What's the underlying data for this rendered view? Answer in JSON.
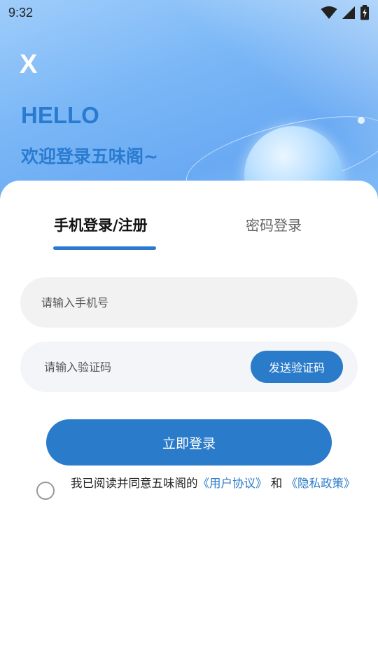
{
  "status_bar": {
    "time": "9:32",
    "icons": [
      "wifi-icon",
      "cell-signal-icon",
      "battery-charging-icon"
    ]
  },
  "header": {
    "close_label": "X",
    "hello": "HELLO",
    "welcome": "欢迎登录五味阁~"
  },
  "tabs": [
    {
      "label": "手机登录/注册",
      "active": true
    },
    {
      "label": "密码登录",
      "active": false
    }
  ],
  "form": {
    "phone_placeholder": "请输入手机号",
    "code_placeholder": "请输入验证码",
    "send_code_label": "发送验证码",
    "login_label": "立即登录"
  },
  "agreement": {
    "prefix": "我已阅读并同意五味阁的",
    "user_agreement": "《用户协议》",
    "joiner": " 和 ",
    "privacy_policy": "《隐私政策》",
    "checked": false
  },
  "colors": {
    "accent": "#2a7bc9",
    "title": "#2a7bd0",
    "hero_bg": "#79b6f6"
  }
}
